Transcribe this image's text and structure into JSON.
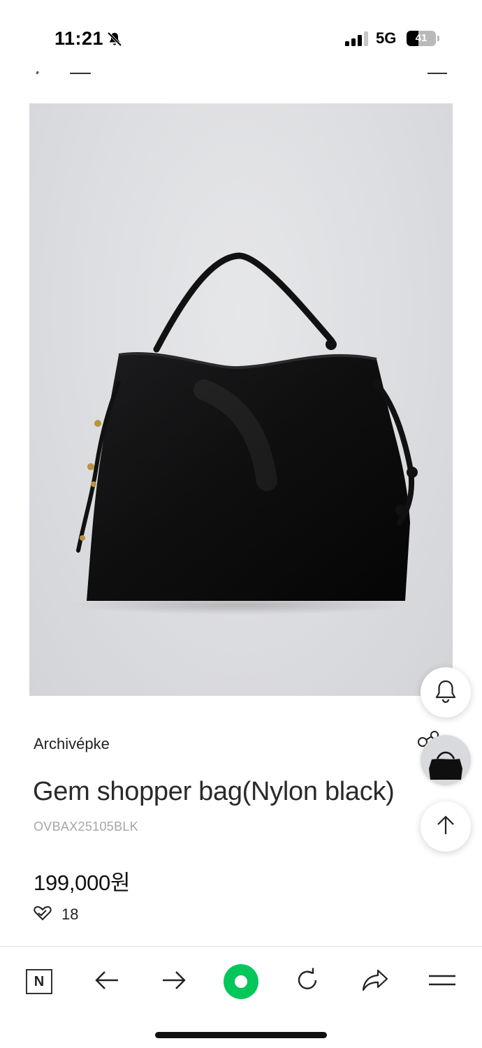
{
  "status_bar": {
    "time": "11:21",
    "network": "5G",
    "battery": "41",
    "battery_level": 0.41
  },
  "product": {
    "image_description_icon": "black-nylon-shopper-bag",
    "brand": "Archivépke",
    "name": "Gem shopper bag(Nylon black)",
    "code": "OVBAX25105BLK",
    "price": "199,000원",
    "likes": "18"
  },
  "floating": {
    "alarm_icon": "bell-icon",
    "top_icon": "arrow-up-icon",
    "recent_icon": "recent-product-thumbnail"
  },
  "toolbar": {
    "n_label": "N",
    "items": [
      "naver-n-icon",
      "back-arrow-icon",
      "forward-arrow-icon",
      "green-dot-icon",
      "reload-icon",
      "share-icon",
      "menu-icon"
    ]
  },
  "colors": {
    "accent_green": "#03c75a",
    "text": "#222222",
    "muted": "#a6a6a6"
  }
}
